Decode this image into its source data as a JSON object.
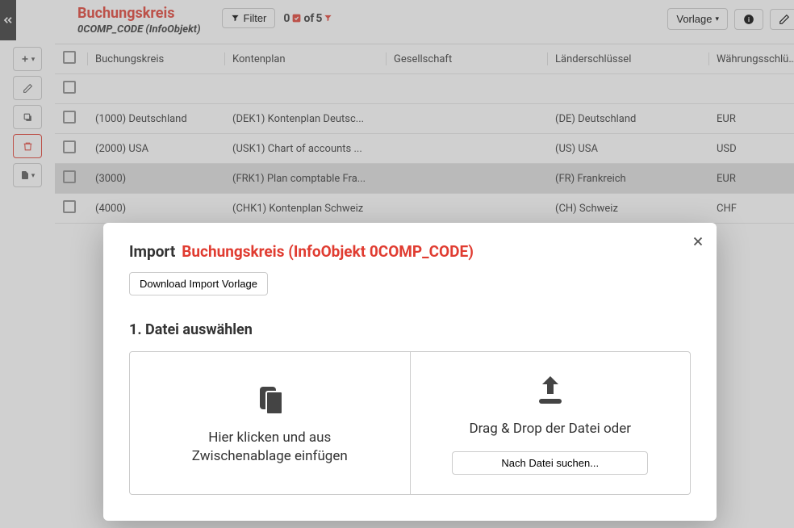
{
  "header": {
    "title": "Buchungskreis",
    "subtitle": "0COMP_CODE (InfoObjekt)",
    "filter_label": "Filter",
    "count_prefix": "0",
    "count_mid": " of ",
    "count_total": "5",
    "vorlage_label": "Vorlage"
  },
  "columns": {
    "c1": "Buchungskreis",
    "c2": "Kontenplan",
    "c3": "Gesellschaft",
    "c4": "Länderschlüssel",
    "c5": "Währungsschlüssel"
  },
  "rows": [
    {
      "c1": "(1000) Deutschland",
      "c2": "(DEK1) Kontenplan Deutsc...",
      "c3": "",
      "c4": "(DE) Deutschland",
      "c5": "EUR",
      "selected": false
    },
    {
      "c1": "(2000) USA",
      "c2": "(USK1) Chart of accounts ...",
      "c3": "",
      "c4": "(US) USA",
      "c5": "USD",
      "selected": false
    },
    {
      "c1": "(3000)",
      "c2": "(FRK1) Plan comptable Fra...",
      "c3": "",
      "c4": "(FR) Frankreich",
      "c5": "EUR",
      "selected": true
    },
    {
      "c1": "(4000)",
      "c2": "(CHK1) Kontenplan Schweiz",
      "c3": "",
      "c4": "(CH) Schweiz",
      "c5": "CHF",
      "selected": false
    }
  ],
  "modal": {
    "import_label": "Import",
    "object_label": "Buchungskreis (InfoObjekt 0COMP_CODE)",
    "download_label": "Download Import Vorlage",
    "step_title": "1. Datei auswählen",
    "clipboard_text_line1": "Hier klicken und aus",
    "clipboard_text_line2": "Zwischenablage einfügen",
    "dragdrop_text": "Drag & Drop der Datei oder",
    "browse_label": "Nach Datei suchen..."
  }
}
